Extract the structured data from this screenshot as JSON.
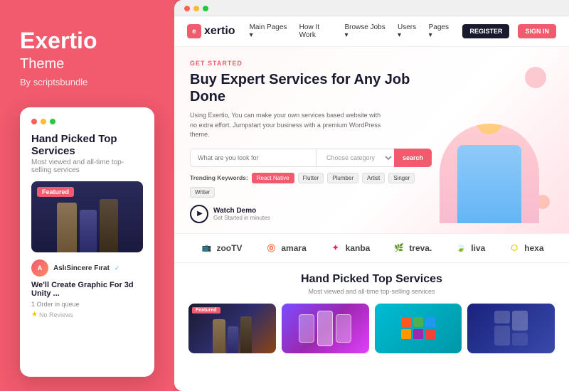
{
  "left": {
    "title": "Exertio",
    "subtitle": "Theme",
    "by": "By scriptsbundle",
    "mobile_card": {
      "title": "Hand Picked Top Services",
      "subtitle": "Most viewed and all-time top-selling services",
      "featured_label": "Featured",
      "user": "AslıSincere Fırat",
      "service_title": "We'll Create Graphic For 3d Unity ...",
      "orders": "1 Order in queue",
      "no_reviews": "No Reviews"
    }
  },
  "browser": {
    "dots": [
      "red",
      "yellow",
      "green"
    ]
  },
  "nav": {
    "logo": "exertio",
    "logo_prefix": "e",
    "links": [
      {
        "label": "Main Pages",
        "has_arrow": true
      },
      {
        "label": "How It Work",
        "has_arrow": false
      },
      {
        "label": "Browse Jobs",
        "has_arrow": true
      },
      {
        "label": "Users",
        "has_arrow": true
      },
      {
        "label": "Pages",
        "has_arrow": true
      }
    ],
    "register_label": "REGISTER",
    "signin_label": "SIGN IN"
  },
  "hero": {
    "get_started": "GET STARTED",
    "title": "Buy Expert Services for Any Job Done",
    "desc": "Using Exertio, You can make your own services based website with no extra effort. Jumpstart your business with a premium WordPress theme.",
    "search_placeholder": "What are you look for",
    "search_category": "Choose category",
    "search_btn": "search",
    "trending_label": "Trending Keywords:",
    "trending_tags": [
      "React Native",
      "Flutter",
      "Plumber",
      "Artist",
      "Singer",
      "Writer"
    ],
    "watch_label": "Watch Demo",
    "watch_sub": "Get Started in minutes"
  },
  "brands": [
    {
      "name": "zooTV",
      "icon": "📺",
      "color": "#2196f3"
    },
    {
      "name": "amara",
      "icon": "⓪",
      "color": "#ff5722"
    },
    {
      "name": "kanba",
      "icon": "✦",
      "color": "#e91e63"
    },
    {
      "name": "treva.",
      "icon": "🌿",
      "color": "#4caf50"
    },
    {
      "name": "liva",
      "icon": "🍃",
      "color": "#8bc34a"
    },
    {
      "name": "hexa",
      "icon": "⬡",
      "color": "#ffc107"
    }
  ],
  "services": {
    "title": "Hand Picked Top Services",
    "subtitle": "Most viewed and all-time top-selling services",
    "featured_label": "Featured",
    "cards": [
      {
        "type": "characters",
        "featured": true
      },
      {
        "type": "phones",
        "featured": false
      },
      {
        "type": "cubes",
        "featured": false
      },
      {
        "type": "apps",
        "featured": false
      }
    ]
  }
}
